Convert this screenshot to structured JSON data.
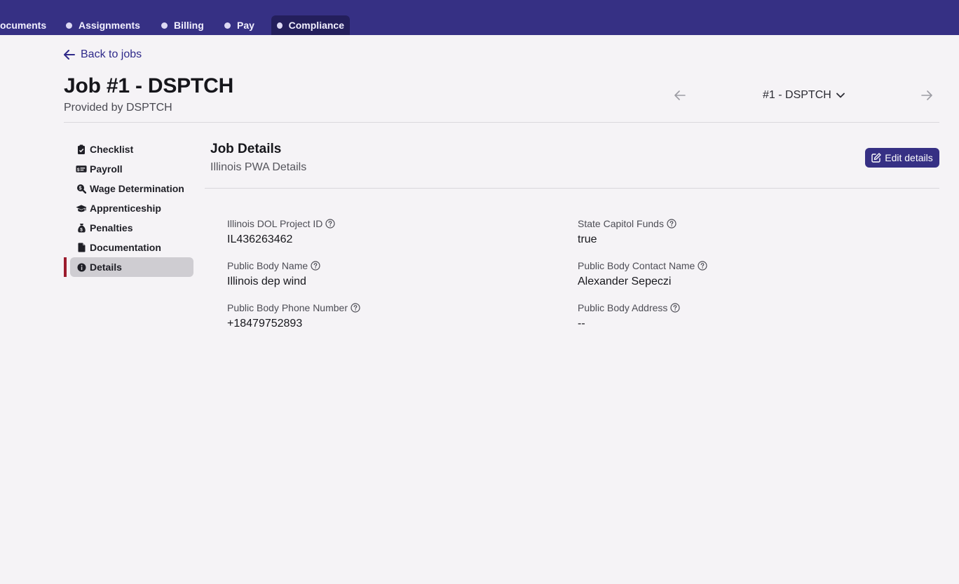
{
  "tabs": [
    {
      "label": "Documents",
      "visible": "ocuments",
      "active": false
    },
    {
      "label": "Assignments",
      "active": false
    },
    {
      "label": "Billing",
      "active": false
    },
    {
      "label": "Pay",
      "active": false
    },
    {
      "label": "Compliance",
      "active": true
    }
  ],
  "back_link": "Back to jobs",
  "header": {
    "title": "Job #1 - DSPTCH",
    "subtitle": "Provided by DSPTCH",
    "job_selector": "#1 - DSPTCH"
  },
  "sidebar": {
    "items": [
      {
        "label": "Checklist",
        "icon": "clipboard-check-icon"
      },
      {
        "label": "Payroll",
        "icon": "money-check-icon"
      },
      {
        "label": "Wage Determination",
        "icon": "search-dollar-icon"
      },
      {
        "label": "Apprenticeship",
        "icon": "graduation-cap-icon"
      },
      {
        "label": "Penalties",
        "icon": "money-bag-icon"
      },
      {
        "label": "Documentation",
        "icon": "file-icon"
      },
      {
        "label": "Details",
        "icon": "info-circle-icon",
        "active": true
      }
    ]
  },
  "panel": {
    "title": "Job Details",
    "subtitle": "Illinois PWA Details",
    "edit_label": "Edit details"
  },
  "fields": [
    {
      "label": "Illinois DOL Project ID",
      "value": "IL436263462"
    },
    {
      "label": "State Capitol Funds",
      "value": "true"
    },
    {
      "label": "Public Body Name",
      "value": "Illinois dep wind"
    },
    {
      "label": "Public Body Contact Name",
      "value": "Alexander Sepeczi"
    },
    {
      "label": "Public Body Phone Number",
      "value": "+18479752893"
    },
    {
      "label": "Public Body Address",
      "value": "--"
    }
  ],
  "colors": {
    "nav_bg": "#363084",
    "nav_active": "#241f5c",
    "primary": "#363084",
    "active_marker": "#9b1b2e",
    "page_bg": "#f5f3f6"
  }
}
